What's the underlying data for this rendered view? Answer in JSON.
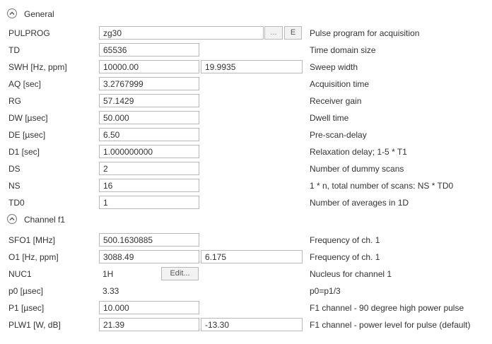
{
  "sections": [
    {
      "title": "General",
      "rows": [
        {
          "label": "PULPROG",
          "value": "zg30",
          "desc": "Pulse program for acquisition"
        },
        {
          "label": "TD",
          "value": "65536",
          "desc": "Time domain size"
        },
        {
          "label": "SWH [Hz, ppm]",
          "value": "10000.00",
          "value2": "19.9935",
          "desc": "Sweep width"
        },
        {
          "label": "AQ [sec]",
          "value": "3.2767999",
          "desc": "Acquisition time"
        },
        {
          "label": "RG",
          "value": "57.1429",
          "desc": "Receiver gain"
        },
        {
          "label": "DW [µsec]",
          "value": "50.000",
          "desc": "Dwell time"
        },
        {
          "label": "DE [µsec]",
          "value": "6.50",
          "desc": "Pre-scan-delay"
        },
        {
          "label": "D1 [sec]",
          "value": "1.000000000",
          "desc": "Relaxation delay; 1-5 * T1"
        },
        {
          "label": "DS",
          "value": "2",
          "desc": "Number of dummy scans"
        },
        {
          "label": "NS",
          "value": "16",
          "desc": "1 * n, total number of scans: NS * TD0"
        },
        {
          "label": "TD0",
          "value": "1",
          "desc": "Number of averages in 1D"
        }
      ]
    },
    {
      "title": "Channel f1",
      "rows": [
        {
          "label": "SFO1 [MHz]",
          "value": "500.1630885",
          "desc": "Frequency of ch. 1"
        },
        {
          "label": "O1 [Hz, ppm]",
          "value": "3088.49",
          "value2": "6.175",
          "desc": "Frequency of ch. 1"
        },
        {
          "label": "NUC1",
          "value": "1H",
          "desc": "Nucleus for channel 1"
        },
        {
          "label": "p0 [µsec]",
          "value": "3.33",
          "desc": "p0=p1/3"
        },
        {
          "label": "P1 [µsec]",
          "value": "10.000",
          "desc": "F1 channel -  90 degree high power pulse"
        },
        {
          "label": "PLW1 [W, dB]",
          "value": "21.39",
          "value2": "-13.30",
          "desc": "F1 channel - power level for pulse (default)"
        }
      ]
    }
  ],
  "buttons": {
    "browse": "...",
    "edit_pulprog": "E",
    "edit_nuc": "Edit..."
  }
}
